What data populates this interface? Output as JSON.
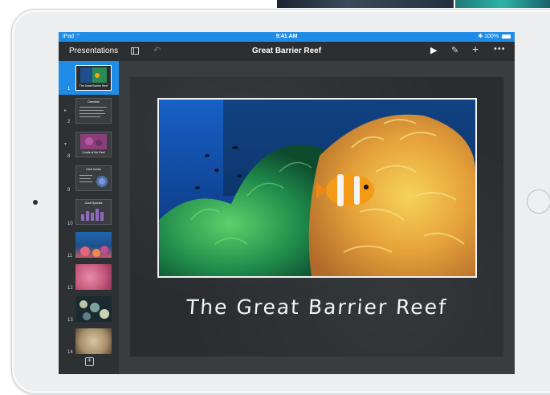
{
  "status_bar": {
    "left": "iPad",
    "wifi_icon": "wifi-icon",
    "time": "9:41 AM",
    "bluetooth": "✱",
    "battery": "100%"
  },
  "toolbar": {
    "back_label": "Presentations",
    "title": "Great Barrier Reef",
    "icons": [
      "panel-icon",
      "undo-icon",
      "play-icon",
      "format-brush-icon",
      "plus-icon",
      "more-icon"
    ]
  },
  "navigator": {
    "slides": [
      {
        "number": "1",
        "title": "The Great Barrier Reef",
        "kind": "photo-title"
      },
      {
        "number": "2",
        "title": "Overview",
        "kind": "text"
      },
      {
        "number": "8",
        "title": "Corals of the Reef",
        "kind": "photo-title"
      },
      {
        "number": "9",
        "title": "Hard Corals",
        "kind": "text-photo"
      },
      {
        "number": "10",
        "title": "Coral Species",
        "kind": "chart"
      },
      {
        "number": "11",
        "title": "",
        "kind": "photo"
      },
      {
        "number": "12",
        "title": "",
        "kind": "photo"
      },
      {
        "number": "13",
        "title": "",
        "kind": "photo"
      },
      {
        "number": "14",
        "title": "",
        "kind": "photo"
      }
    ],
    "add_label": "+"
  },
  "slide": {
    "title": "The Great Barrier Reef"
  },
  "colors": {
    "accent": "#1f8de8",
    "toolbar": "#2c2f32",
    "canvas": "#3a3d40",
    "chalkboard": "#2a2d30"
  }
}
